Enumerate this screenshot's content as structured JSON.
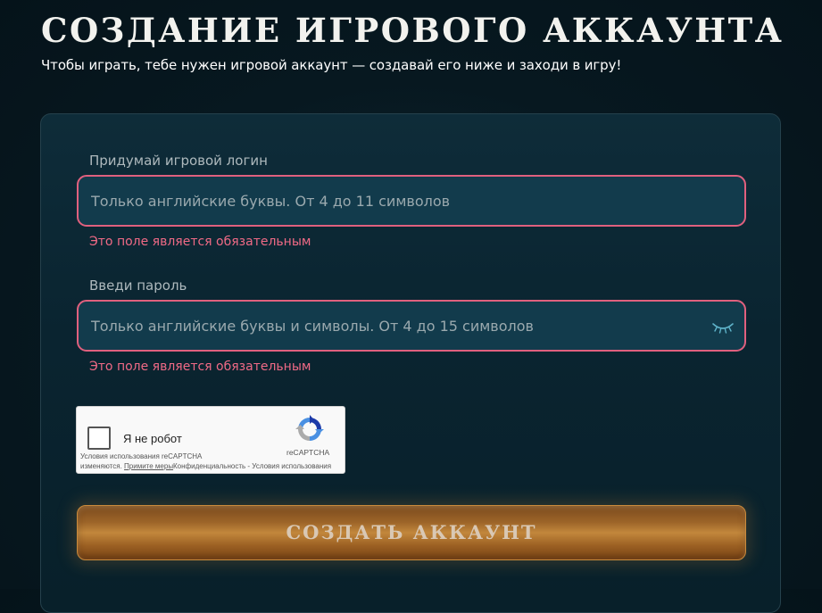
{
  "header": {
    "title": "СОЗДАНИЕ ИГРОВОГО АККАУНТА",
    "subtitle": "Чтобы играть, тебе нужен игровой аккаунт — создавай его ниже и заходи в игру!"
  },
  "form": {
    "login": {
      "label": "Придумай игровой логин",
      "value": "",
      "placeholder": "Только английские буквы. От 4 до 11 символов",
      "error": "Это поле является обязательным"
    },
    "password": {
      "label": "Введи пароль",
      "value": "",
      "placeholder": "Только английские буквы и символы. От 4 до 15 символов",
      "error": "Это поле является обязательным",
      "toggle_icon": "eye-closed-icon"
    },
    "recaptcha": {
      "checkbox_label": "Я не робот",
      "brand": "reCAPTCHA",
      "terms_line1": "Условия использования reCAPTCHA",
      "terms_line2": "изменяются.",
      "terms_link": "Примите меры",
      "privacy": "Конфиденциальность",
      "separator": " - ",
      "terms": "Условия использования"
    },
    "submit_label": "СОЗДАТЬ АККАУНТ"
  },
  "colors": {
    "background": "#071820",
    "card": "#0c2834",
    "input_bg": "#123b4c",
    "error_border": "#e0607e",
    "error_text": "#f06a86",
    "button": "#c2873c"
  }
}
